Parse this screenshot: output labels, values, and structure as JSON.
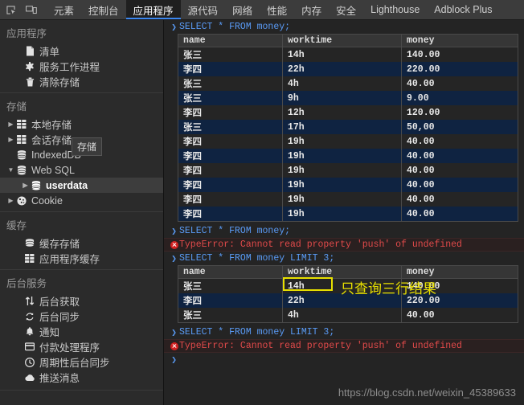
{
  "toolbar": {
    "inspect_icon": "inspect-element-icon",
    "device_icon": "device-toolbar-icon"
  },
  "tabs": [
    {
      "label": "元素",
      "active": false
    },
    {
      "label": "控制台",
      "active": false
    },
    {
      "label": "应用程序",
      "active": true
    },
    {
      "label": "源代码",
      "active": false
    },
    {
      "label": "网络",
      "active": false
    },
    {
      "label": "性能",
      "active": false
    },
    {
      "label": "内存",
      "active": false
    },
    {
      "label": "安全",
      "active": false
    },
    {
      "label": "Lighthouse",
      "active": false
    },
    {
      "label": "Adblock Plus",
      "active": false
    }
  ],
  "sidebar": {
    "tooltip": "存储",
    "sections": [
      {
        "title": "应用程序",
        "items": [
          {
            "label": "清单",
            "icon": "manifest-file-icon",
            "glyph": "⬛",
            "arrow": "",
            "selected": false
          },
          {
            "label": "服务工作进程",
            "icon": "gear-icon",
            "glyph": "⚙",
            "arrow": "",
            "selected": false
          },
          {
            "label": "清除存储",
            "icon": "trash-icon",
            "glyph": "🗑",
            "arrow": "",
            "selected": false
          }
        ]
      },
      {
        "title": "存储",
        "items": [
          {
            "label": "本地存储",
            "icon": "table-grid-icon",
            "glyph": "▦",
            "arrow": "▶",
            "selected": false
          },
          {
            "label": "会话存储",
            "icon": "table-grid-icon",
            "glyph": "▦",
            "arrow": "▶",
            "selected": false
          },
          {
            "label": "IndexedDB",
            "icon": "database-icon",
            "glyph": "⛃",
            "arrow": "",
            "selected": false
          },
          {
            "label": "Web SQL",
            "icon": "database-icon",
            "glyph": "⛃",
            "arrow": "▼",
            "selected": false
          },
          {
            "label": "userdata",
            "icon": "database-icon",
            "glyph": "⛃",
            "arrow": "▶",
            "selected": true,
            "nested": true
          },
          {
            "label": "Cookie",
            "icon": "cookie-icon",
            "glyph": "●",
            "arrow": "▶",
            "selected": false
          }
        ]
      },
      {
        "title": "缓存",
        "items": [
          {
            "label": "缓存存储",
            "icon": "database-icon",
            "glyph": "⛃",
            "arrow": "",
            "selected": false
          },
          {
            "label": "应用程序缓存",
            "icon": "table-grid-icon",
            "glyph": "▦",
            "arrow": "",
            "selected": false
          }
        ]
      },
      {
        "title": "后台服务",
        "items": [
          {
            "label": "后台获取",
            "icon": "arrows-updown-icon",
            "glyph": "⇅",
            "arrow": "",
            "selected": false
          },
          {
            "label": "后台同步",
            "icon": "sync-icon",
            "glyph": "↻",
            "arrow": "",
            "selected": false
          },
          {
            "label": "通知",
            "icon": "bell-icon",
            "glyph": "🔔",
            "arrow": "",
            "selected": false
          },
          {
            "label": "付款处理程序",
            "icon": "credit-card-icon",
            "glyph": "▤",
            "arrow": "",
            "selected": false
          },
          {
            "label": "周期性后台同步",
            "icon": "clock-icon",
            "glyph": "◴",
            "arrow": "",
            "selected": false
          },
          {
            "label": "推送消息",
            "icon": "cloud-icon",
            "glyph": "☁",
            "arrow": "",
            "selected": false
          }
        ]
      }
    ]
  },
  "console": {
    "prompt_glyph": ">",
    "error_text": "TypeError: Cannot read property 'push' of undefined",
    "entries": [
      {
        "type": "command",
        "text": "SELECT * FROM money;"
      },
      {
        "type": "table",
        "ref": "table_full"
      },
      {
        "type": "command",
        "text": "SELECT * FROM money;"
      },
      {
        "type": "error",
        "text": "TypeError: Cannot read property 'push' of undefined"
      },
      {
        "type": "command",
        "text": "SELECT * FROM money LIMIT 3;"
      },
      {
        "type": "table",
        "ref": "table_limit"
      },
      {
        "type": "command",
        "text": "SELECT * FROM money LIMIT 3;"
      },
      {
        "type": "error",
        "text": "TypeError: Cannot read property 'push' of undefined"
      },
      {
        "type": "prompt",
        "text": ""
      }
    ],
    "columns": [
      "name",
      "worktime",
      "money"
    ],
    "table_full": [
      [
        "张三",
        "14h",
        "140.00"
      ],
      [
        "李四",
        "22h",
        "220.00"
      ],
      [
        "张三",
        "4h",
        "40.00"
      ],
      [
        "张三",
        "9h",
        "9.00"
      ],
      [
        "李四",
        "12h",
        "120.00"
      ],
      [
        "张三",
        "17h",
        "50,00"
      ],
      [
        "李四",
        "19h",
        "40.00"
      ],
      [
        "李四",
        "19h",
        "40.00"
      ],
      [
        "李四",
        "19h",
        "40.00"
      ],
      [
        "李四",
        "19h",
        "40.00"
      ],
      [
        "李四",
        "19h",
        "40.00"
      ],
      [
        "李四",
        "19h",
        "40.00"
      ]
    ],
    "table_limit": [
      [
        "张三",
        "14h",
        "140.00"
      ],
      [
        "李四",
        "22h",
        "220.00"
      ],
      [
        "张三",
        "4h",
        "40.00"
      ]
    ]
  },
  "annotations": {
    "highlight_fragment": "LIMIT 3;",
    "note_text": "只查询三行结果",
    "color": "#e8e000"
  },
  "watermark": "https://blog.csdn.net/weixin_45389633"
}
